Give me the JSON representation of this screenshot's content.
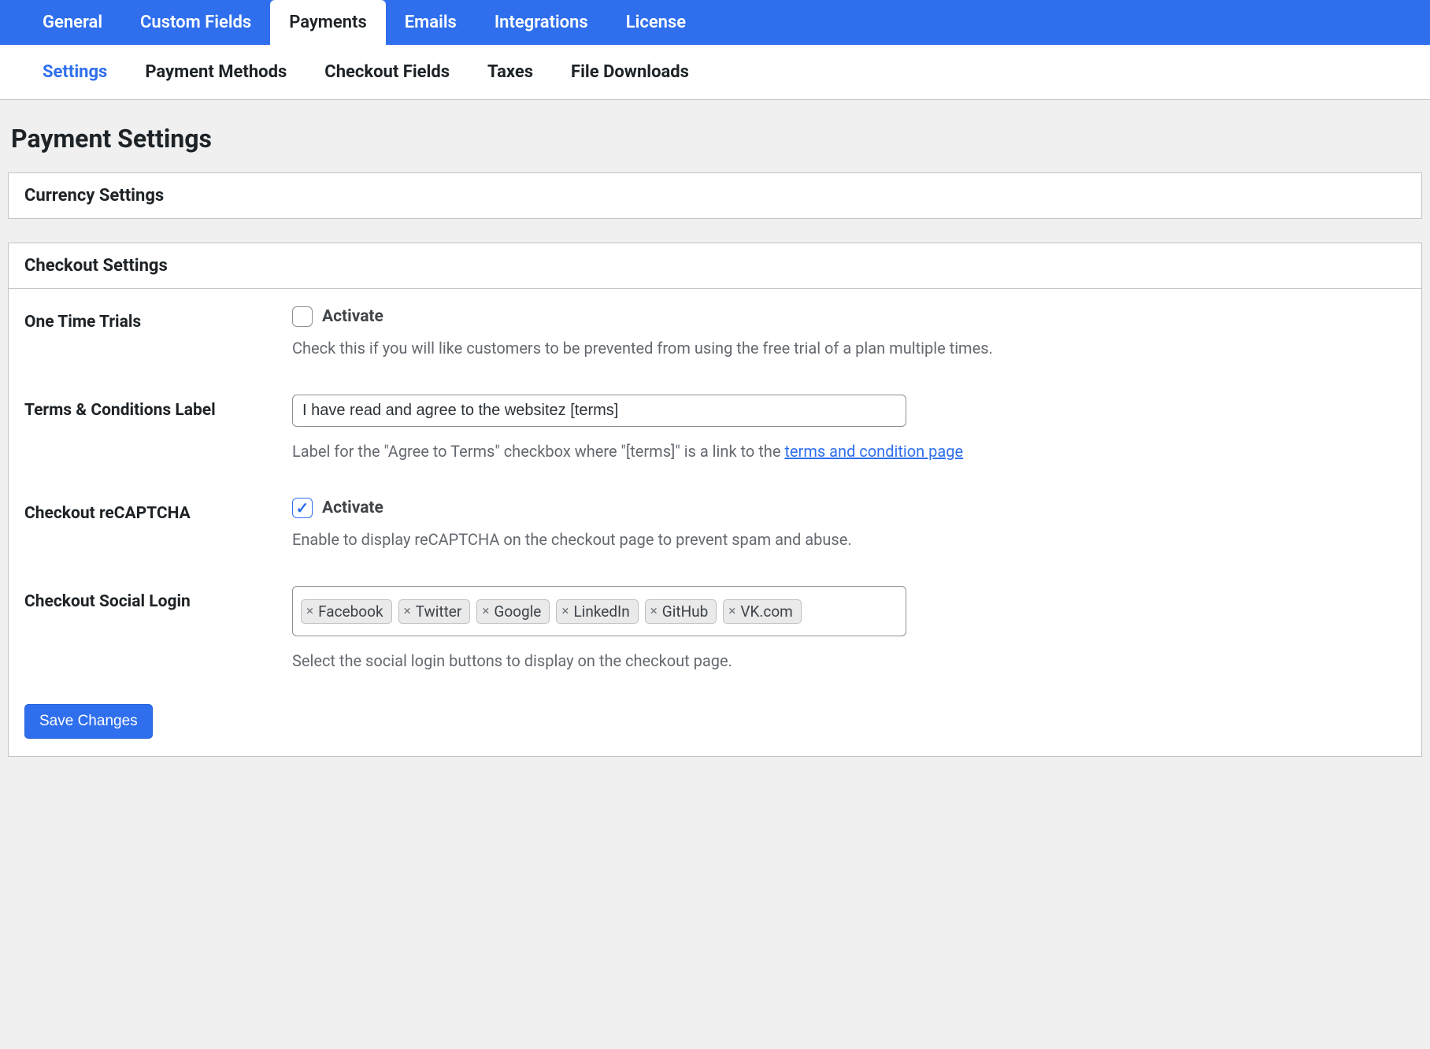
{
  "topTabs": {
    "general": "General",
    "customFields": "Custom Fields",
    "payments": "Payments",
    "emails": "Emails",
    "integrations": "Integrations",
    "license": "License"
  },
  "subTabs": {
    "settings": "Settings",
    "paymentMethods": "Payment Methods",
    "checkoutFields": "Checkout Fields",
    "taxes": "Taxes",
    "fileDownloads": "File Downloads"
  },
  "pageTitle": "Payment Settings",
  "panels": {
    "currency": {
      "title": "Currency Settings"
    },
    "checkout": {
      "title": "Checkout Settings",
      "oneTimeTrials": {
        "label": "One Time Trials",
        "checkboxLabel": "Activate",
        "checked": false,
        "help": "Check this if you will like customers to be prevented from using the free trial of a plan multiple times."
      },
      "termsLabel": {
        "label": "Terms & Conditions Label",
        "value": "I have read and agree to the websitez [terms]",
        "helpPrefix": "Label for the \"Agree to Terms\" checkbox where \"[terms]\" is a link to the ",
        "helpLink": "terms and condition page"
      },
      "recaptcha": {
        "label": "Checkout reCAPTCHA",
        "checkboxLabel": "Activate",
        "checked": true,
        "help": "Enable to display reCAPTCHA on the checkout page to prevent spam and abuse."
      },
      "socialLogin": {
        "label": "Checkout Social Login",
        "tags": [
          "Facebook",
          "Twitter",
          "Google",
          "LinkedIn",
          "GitHub",
          "VK.com"
        ],
        "help": "Select the social login buttons to display on the checkout page."
      }
    }
  },
  "saveButton": "Save Changes"
}
